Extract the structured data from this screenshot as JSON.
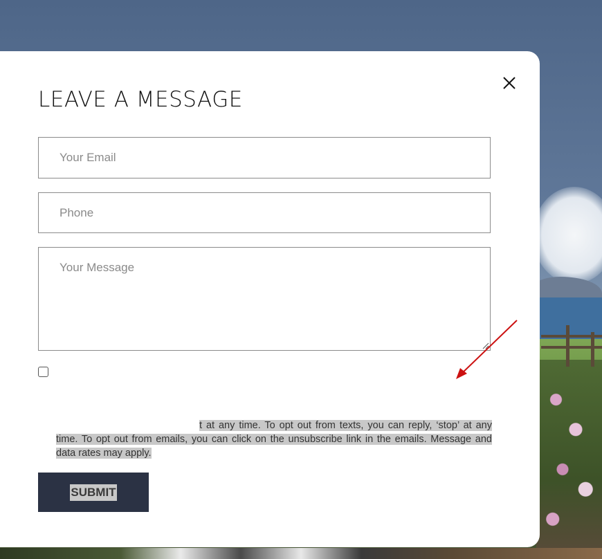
{
  "modal": {
    "title": "LEAVE A MESSAGE",
    "close_icon": "close-icon"
  },
  "form": {
    "email_placeholder": "Your Email",
    "phone_placeholder": "Phone",
    "message_placeholder": "Your Message",
    "consent_checked": false,
    "consent_text": "t at any time. To opt out from texts, you can reply, ‘stop’ at any time. To opt out from emails, you can click on the unsubscribe link in the emails. Message and data rates may apply.",
    "submit_label": "SUBMIT"
  },
  "colors": {
    "submit_bg": "#2b3244",
    "arrow": "#cc1111",
    "highlight": "#c8c8c8"
  }
}
